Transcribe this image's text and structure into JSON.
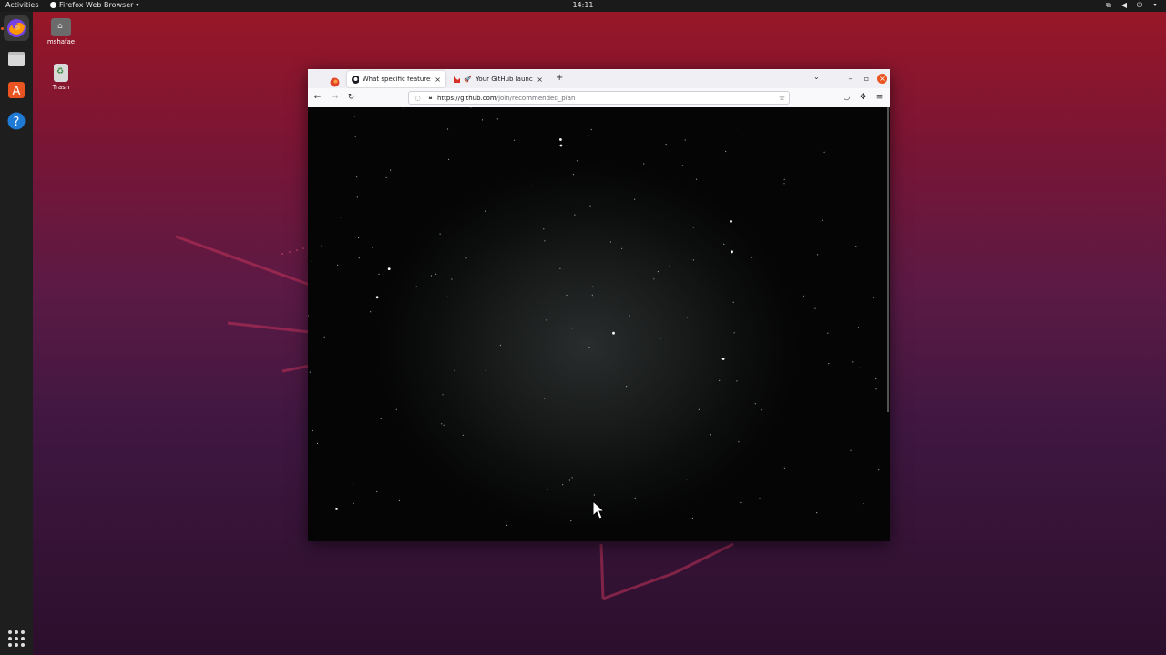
{
  "topbar": {
    "activities": "Activities",
    "app_menu": "Firefox Web Browser",
    "clock": "14:11"
  },
  "desktop": {
    "icons": [
      {
        "label": "mshafae",
        "icon": "home-folder-icon"
      },
      {
        "label": "Trash",
        "icon": "trash-icon"
      }
    ]
  },
  "dock": {
    "items": [
      "firefox-icon",
      "files-icon",
      "software-center-icon",
      "help-icon"
    ],
    "apps_button": "show-applications-icon"
  },
  "browser": {
    "tabs": [
      {
        "title": "What specific features ar",
        "active": true
      },
      {
        "title": "Your GitHub launch co",
        "active": false
      }
    ],
    "url_domain": "https://github.com",
    "url_path": "/join/recommended_plan"
  },
  "colors": {
    "accent": "#e95420",
    "page_background": "#0a0b0b"
  }
}
